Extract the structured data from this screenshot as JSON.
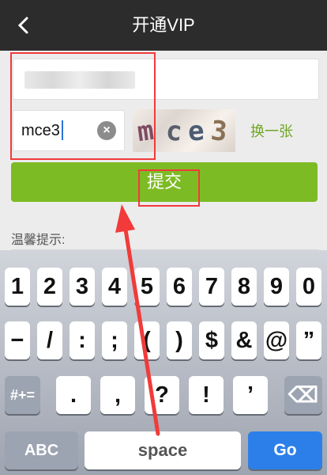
{
  "header": {
    "back_icon": "chevron-left-icon",
    "title": "开通VIP"
  },
  "form": {
    "phone_value": "",
    "captcha_value": "mce3",
    "captcha_image_text": [
      "m",
      "c",
      "e",
      "3"
    ],
    "clear_icon": "×",
    "refresh_label": "换一张",
    "submit_label": "提交"
  },
  "tips": {
    "title": "温馨提示:"
  },
  "keyboard": {
    "row1": [
      "1",
      "2",
      "3",
      "4",
      "5",
      "6",
      "7",
      "8",
      "9",
      "0"
    ],
    "row2": [
      "−",
      "/",
      ":",
      ";",
      "(",
      ")",
      "$",
      "&",
      "@",
      "”"
    ],
    "row3": [
      "#+=",
      ".",
      ",",
      "?",
      "!",
      "’",
      "⌫"
    ],
    "row4": [
      "ABC",
      "space",
      "Go"
    ]
  },
  "colors": {
    "accent_green": "#7dbb24",
    "link_green": "#70a624",
    "header_bg": "#2c2c2c",
    "annotation_red": "#f23a3a"
  }
}
